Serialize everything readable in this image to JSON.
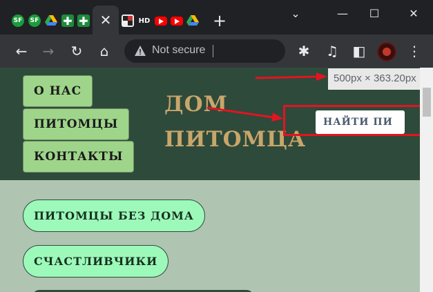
{
  "browser": {
    "tabs": [
      {
        "icon": "sf-icon",
        "label": "SF"
      },
      {
        "icon": "sf-icon",
        "label": "SF"
      },
      {
        "icon": "google-drive-icon",
        "label": ""
      },
      {
        "icon": "cross-icon",
        "label": "✚"
      },
      {
        "icon": "cross-icon",
        "label": "✚"
      },
      {
        "icon": "close-icon",
        "label": "✕"
      },
      {
        "icon": "grid-favicon-icon",
        "label": ""
      },
      {
        "icon": "hd-icon",
        "label": "HD"
      },
      {
        "icon": "youtube-icon",
        "label": ""
      },
      {
        "icon": "youtube-icon",
        "label": ""
      },
      {
        "icon": "google-drive-icon",
        "label": ""
      }
    ],
    "new_tab_glyph": "+",
    "window_controls": {
      "dropdown": "⌄",
      "minimize": "—",
      "maximize": "☐",
      "close": "✕"
    },
    "toolbar": {
      "back": "←",
      "forward": "→",
      "reload": "↻",
      "home": "⌂"
    },
    "address_bar": {
      "security_text": "Not secure",
      "separator": "|"
    },
    "toolbar_right": {
      "share": "⇗",
      "bookmark": "☆",
      "extensions": "✱",
      "media": "♫",
      "sidebar": "◧",
      "menu": "⋮"
    }
  },
  "page": {
    "nav": [
      {
        "label": "О НАС"
      },
      {
        "label": "ПИТОМЦЫ"
      },
      {
        "label": "КОНТАКТЫ"
      }
    ],
    "brand": {
      "line1": "ДОМ",
      "line2": "ПИТОМЦА"
    },
    "search_button": "НАЙТИ ПИ",
    "pills": [
      {
        "label": "ПИТОМЦЫ БЕЗ ДОМА"
      },
      {
        "label": "СЧАСТЛИВЧИКИ"
      }
    ],
    "colors": {
      "header_bg": "#2e4a3b",
      "page_bg": "#b0c4b2",
      "nav_button": "#9ed58a",
      "pill": "#9cf9ba",
      "brand_text": "#c8a66a",
      "annotation_red": "#e3141f"
    }
  },
  "devtools": {
    "element_size": "500px × 363.20px"
  }
}
